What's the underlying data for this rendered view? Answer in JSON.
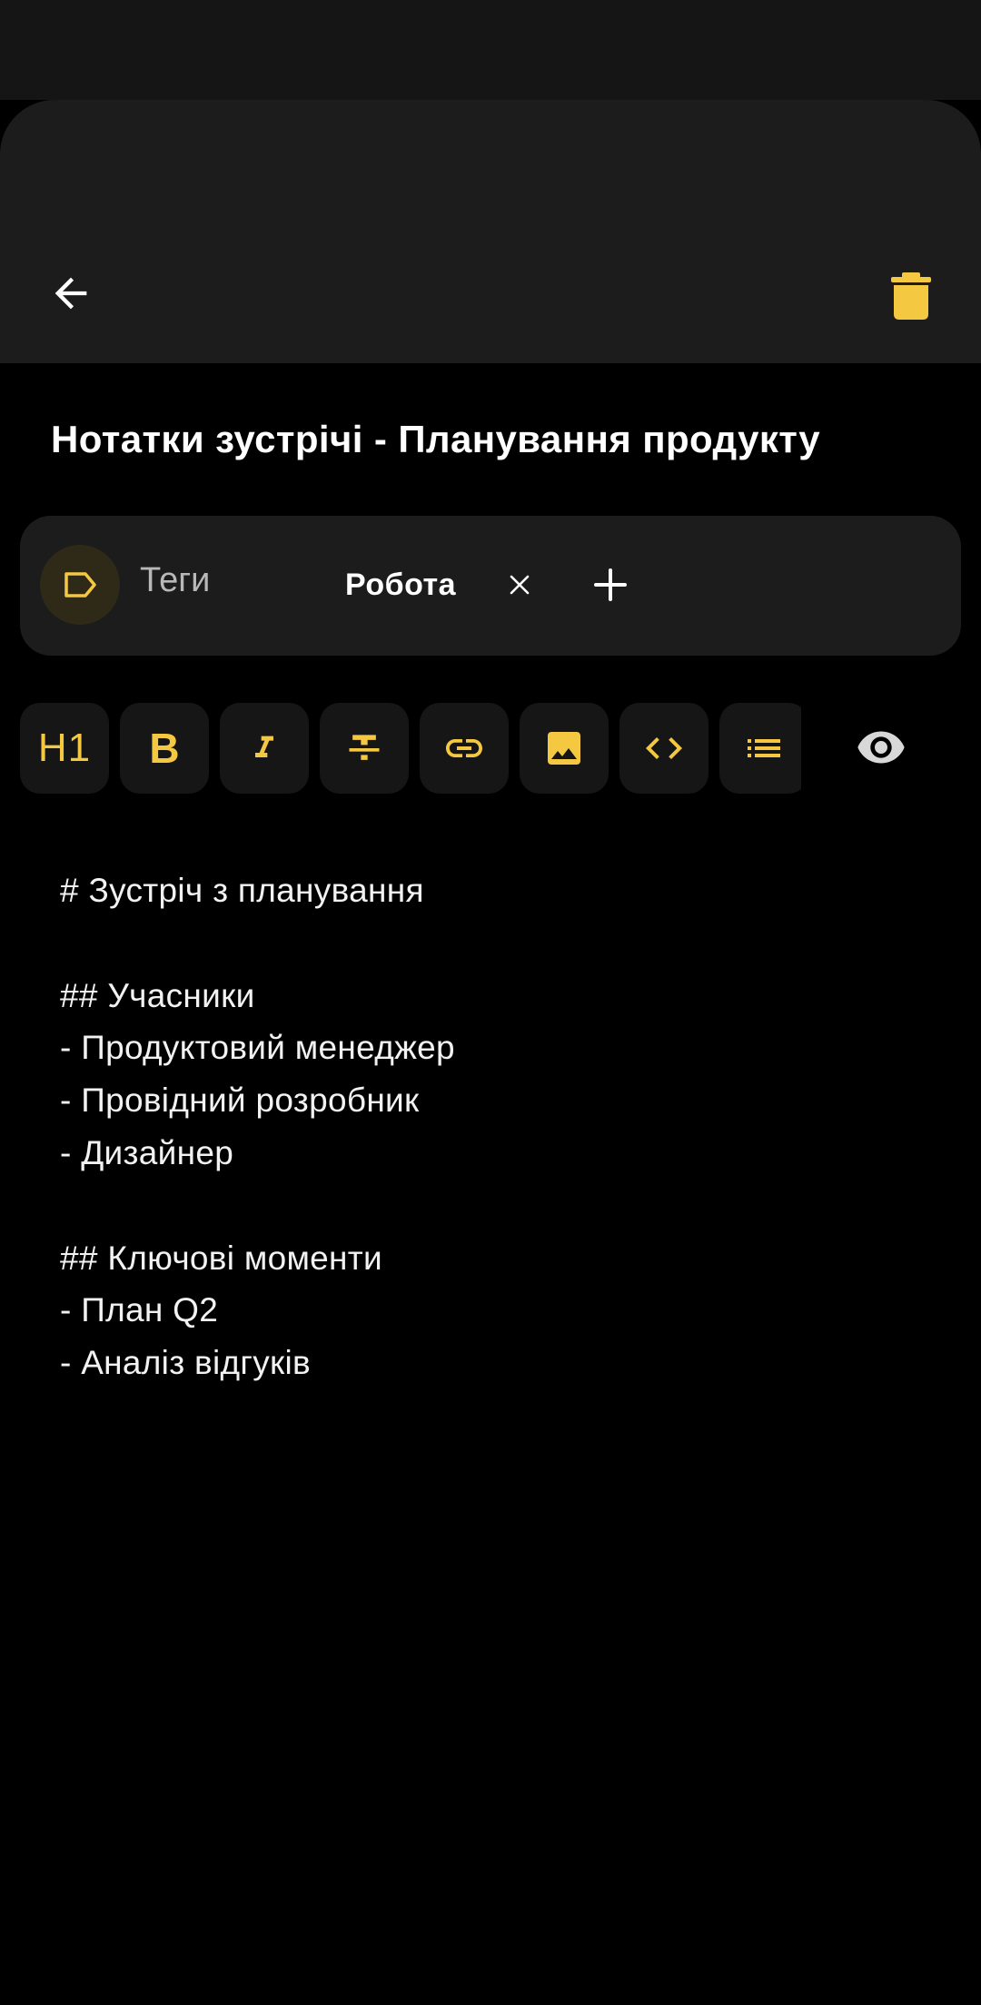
{
  "appbar": {
    "back_icon": "arrow-back-icon",
    "delete_icon": "delete-icon"
  },
  "note": {
    "title": "Нотатки зустрічі - Планування продукту"
  },
  "tags": {
    "label": "Теги",
    "items": [
      {
        "label": "Робота"
      }
    ],
    "remove_symbol": "×",
    "icons": {
      "tag": "label-icon",
      "add": "plus-icon",
      "remove": "close-icon"
    }
  },
  "toolbar": {
    "h1_label": "H1",
    "bold_label": "B",
    "icons": [
      "heading-icon",
      "bold-icon",
      "italic-icon",
      "strikethrough-icon",
      "link-icon",
      "image-icon",
      "code-icon",
      "list-icon",
      "eye-icon"
    ]
  },
  "editor": {
    "lines": [
      "# Зустріч з планування",
      "",
      "## Учасники",
      "- Продуктовий менеджер",
      "- Провідний розробник",
      "- Дизайнер",
      "",
      "## Ключові моменти",
      "- План Q2",
      "- Аналіз відгуків"
    ]
  },
  "colors": {
    "background": "#000000",
    "surface": "#1c1c1c",
    "accent": "#f5c842",
    "text": "#ffffff"
  }
}
